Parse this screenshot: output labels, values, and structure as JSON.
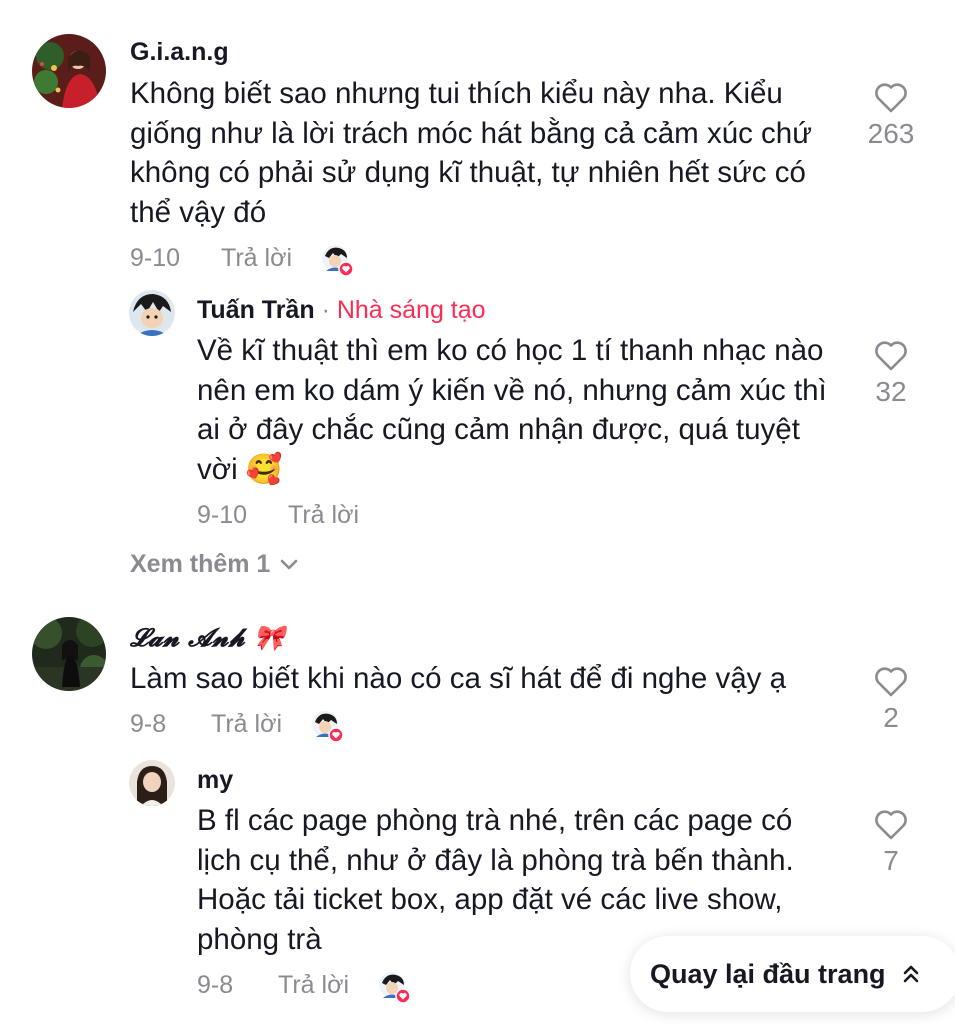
{
  "comments": [
    {
      "username": "G.i.a.n.g",
      "text": "Không biết sao nhưng tui thích kiểu này nha. Kiểu giống như là lời trách móc hát bằng cả cảm xúc chứ không có phải sử dụng kĩ thuật, tự nhiên hết sức có thể vậy đó",
      "date": "9-10",
      "reply_label": "Trả lời",
      "likes": "263",
      "replies": [
        {
          "username": "Tuấn Trần",
          "separator": "·",
          "badge": "Nhà sáng tạo",
          "text": "Về kĩ thuật thì em ko có học 1 tí thanh nhạc nào nên em ko dám ý kiến về nó, nhưng cảm xúc thì ai ở đây chắc cũng cảm nhận được, quá tuyệt vời 🥰",
          "date": "9-10",
          "reply_label": "Trả lời",
          "likes": "32"
        }
      ],
      "see_more_label": "Xem thêm 1"
    },
    {
      "username": "𝓛𝓪𝓷 𝓐𝓷𝓱 🎀",
      "text": "Làm sao biết khi nào có ca sĩ hát để đi nghe vậy ạ",
      "date": "9-8",
      "reply_label": "Trả lời",
      "likes": "2",
      "replies": [
        {
          "username": "my",
          "text": "B fl các page phòng trà nhé, trên các page có lịch cụ thể, như ở đây là phòng trà bến thành. Hoặc tải ticket box, app đặt vé các live show, phòng trà",
          "date": "9-8",
          "reply_label": "Trả lời",
          "likes": "7"
        }
      ]
    }
  ],
  "back_to_top_label": "Quay lại đầu trang",
  "icons": {
    "like": "heart-outline-icon",
    "expand": "chevron-down-icon",
    "back_to_top": "double-chevron-up-icon",
    "creator_liked": "creator-liked-avatar-icon"
  },
  "colors": {
    "accent": "#fe2c55",
    "text": "#161823",
    "muted": "#8a8b91"
  }
}
